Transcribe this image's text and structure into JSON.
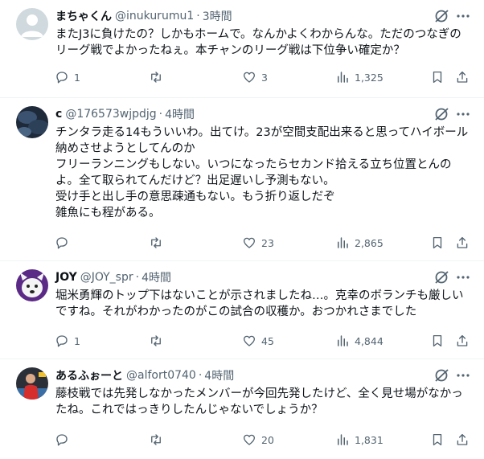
{
  "replies": [
    {
      "name": "まちゃくん",
      "handle": "@inukurumu1",
      "time": "3時間",
      "text": "またJ3に負けたの？しかもホームで。なんかよくわからんな。ただのつなぎのリーグ戦でよかったねぇ。本チャンのリーグ戦は下位争い確定か？",
      "reply_count": "1",
      "retweet_count": "",
      "like_count": "3",
      "view_count": "1,325",
      "avatar": "default-avatar"
    },
    {
      "name": "c",
      "handle": "@176573wjpdjg",
      "time": "4時間",
      "text": "チンタラ走る14もういいわ。出てけ。23が空間支配出来ると思ってハイボール納めさせようとしてんのか\nフリーランニングもしない。いつになったらセカンド拾える立ち位置とんのよ。全て取られてんだけど？出足遅いし予測もない。\n受け手と出し手の意思疎通もない。もう折り返しだぞ\n雑魚にも程がある。",
      "reply_count": "",
      "retweet_count": "",
      "like_count": "23",
      "view_count": "2,865",
      "avatar": "dark-blue-avatar"
    },
    {
      "name": "JOY",
      "handle": "@JOY_spr",
      "time": "4時間",
      "text": "堀米勇輝のトップ下はないことが示されましたね…。克幸のボランチも厳しいですね。それがわかったのがこの試合の収穫か。おつかれさまでした",
      "reply_count": "1",
      "retweet_count": "",
      "like_count": "45",
      "view_count": "4,844",
      "avatar": "dog-mascot-avatar"
    },
    {
      "name": "あるふぉーと",
      "handle": "@alfort0740",
      "time": "4時間",
      "text": "藤枝戦では先発しなかったメンバーが今回先発したけど、全く見せ場がなかったね。これではっきりしたんじゃないでしょうか？",
      "reply_count": "",
      "retweet_count": "",
      "like_count": "20",
      "view_count": "1,831",
      "avatar": "soccer-player-avatar"
    }
  ],
  "separator": "·",
  "colors": {
    "text": "#0f1419",
    "secondary": "#536471",
    "border": "#eff3f4"
  }
}
